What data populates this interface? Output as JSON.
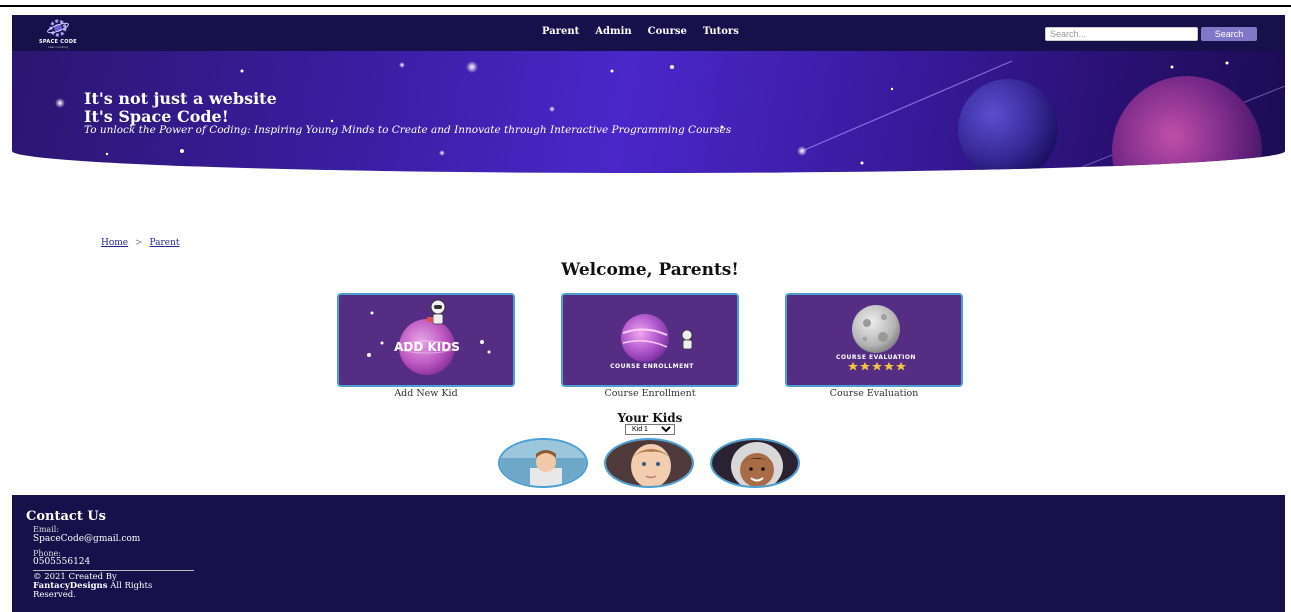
{
  "nav": {
    "logo_text": "SPACE CODE",
    "logo_subtext": "Learn Coding",
    "links": [
      "Parent",
      "Admin",
      "Course",
      "Tutors"
    ],
    "search_placeholder": "Search...",
    "search_button": "Search"
  },
  "hero": {
    "title_line1": "It's not just a website",
    "title_line2": "It's Space Code!",
    "subtitle": "To unlock the Power of Coding: Inspiring Young Minds to Create and Innovate through Interactive Programming Courses"
  },
  "breadcrumb": {
    "home": "Home",
    "separator": ">",
    "current": "Parent"
  },
  "welcome": "Welcome, Parents!",
  "cards": [
    {
      "label": "Add New Kid",
      "image_text": "ADD KIDS"
    },
    {
      "label": "Course Enrollment",
      "image_text": "COURSE ENROLLMENT"
    },
    {
      "label": "Course Evaluation",
      "image_text": "COURSE EVALUATION"
    }
  ],
  "kids": {
    "title": "Your Kids",
    "selected": "Kid 1"
  },
  "footer": {
    "title": "Contact Us",
    "email_label": "Email:",
    "email": "SpaceCode@gmail.com",
    "phone_label": "Phone:",
    "phone": "0505556124",
    "copyright_prefix": "© 2021 Created By",
    "brand": "FantacyDesigns",
    "copyright_suffix": "All Rights Reserved."
  },
  "colors": {
    "nav_bg": "#17104a",
    "search_button": "#8177c7",
    "card_bg": "#552e84",
    "card_border": "#4aa0d6"
  }
}
